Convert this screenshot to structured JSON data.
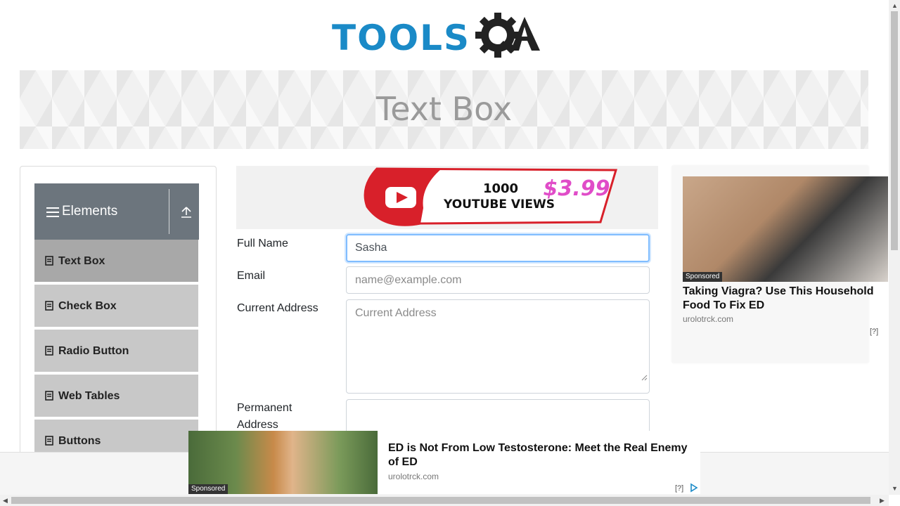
{
  "logo": {
    "text": "TOOLS",
    "text2": "QA",
    "colors": {
      "blue": "#1a8ac7",
      "dark": "#222222"
    }
  },
  "page": {
    "title": "Text Box"
  },
  "sidebar": {
    "group_title": "Elements",
    "group_icon": "hamburger-icon",
    "collapse_icon": "upload-icon",
    "items": [
      {
        "label": "Text Box",
        "active": true
      },
      {
        "label": "Check Box",
        "active": false
      },
      {
        "label": "Radio Button",
        "active": false
      },
      {
        "label": "Web Tables",
        "active": false
      },
      {
        "label": "Buttons",
        "active": false
      }
    ]
  },
  "ad_top": {
    "line1": "1000",
    "line2": "YOUTUBE VIEWS",
    "price": "$3.99"
  },
  "form": {
    "full_name": {
      "label": "Full Name",
      "value": "Sasha"
    },
    "email": {
      "label": "Email",
      "placeholder": "name@example.com"
    },
    "current_address": {
      "label": "Current Address",
      "placeholder": "Current Address"
    },
    "permanent_address": {
      "label_line1": "Permanent",
      "label_line2": "Address"
    }
  },
  "ad_right": {
    "sponsored": "Sponsored",
    "headline": "Taking Viagra? Use This Household Food To Fix ED",
    "source": "urolotrck.com",
    "info": "[?]"
  },
  "ad_bottom": {
    "sponsored": "Sponsored",
    "headline": "ED is Not From Low Testosterone: Meet the Real Enemy of ED",
    "source": "urolotrck.com",
    "info": "[?]"
  },
  "scrollbars": {
    "up": "▲",
    "down": "▼",
    "left": "◀",
    "right": "▶"
  }
}
